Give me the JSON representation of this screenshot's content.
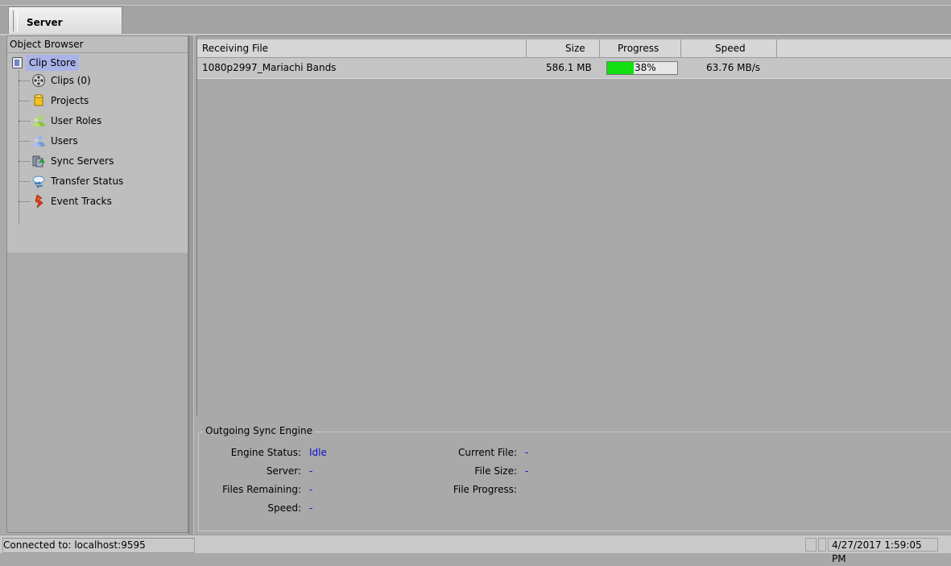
{
  "tab": {
    "label": "Server"
  },
  "object_browser": {
    "title": "Object Browser",
    "root": {
      "label": "Clip Store",
      "icon": "clip-store-icon"
    },
    "items": [
      {
        "label": "Clips (0)",
        "icon": "film-reel-icon"
      },
      {
        "label": "Projects",
        "icon": "database-icon"
      },
      {
        "label": "User Roles",
        "icon": "user-roles-icon"
      },
      {
        "label": "Users",
        "icon": "users-icon"
      },
      {
        "label": "Sync Servers",
        "icon": "sync-servers-icon"
      },
      {
        "label": "Transfer Status",
        "icon": "transfer-status-icon"
      },
      {
        "label": "Event Tracks",
        "icon": "event-tracks-icon"
      }
    ]
  },
  "transfers": {
    "columns": [
      "Receiving File",
      "Size",
      "Progress",
      "Speed"
    ],
    "rows": [
      {
        "file": "1080p2997_Mariachi Bands",
        "size": "586.1 MB",
        "progress_text": "38%",
        "progress": 0.38,
        "speed": "63.76 MB/s"
      }
    ]
  },
  "sync_engine": {
    "title": "Outgoing Sync Engine",
    "engine_status": {
      "label": "Engine Status:",
      "value": "Idle"
    },
    "server": {
      "label": "Server:",
      "value": "-"
    },
    "files_remaining": {
      "label": "Files Remaining:",
      "value": "-"
    },
    "speed": {
      "label": "Speed:",
      "value": "-"
    },
    "current_file": {
      "label": "Current File:",
      "value": "-"
    },
    "file_size": {
      "label": "File Size:",
      "value": "-"
    },
    "file_progress": {
      "label": "File Progress:",
      "value": ""
    }
  },
  "status_bar": {
    "connection": "Connected to: localhost:9595",
    "time": "4/27/2017 1:59:05 PM"
  },
  "colors": {
    "progress_fill": "#10e010",
    "selection": "#aab3e8",
    "link_value": "#1010d0"
  }
}
